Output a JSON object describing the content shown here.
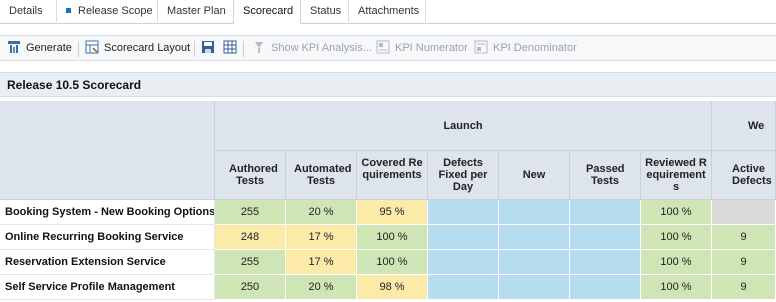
{
  "tabs": [
    {
      "label": "Details"
    },
    {
      "label": "Release Scope",
      "marked": true
    },
    {
      "label": "Master Plan"
    },
    {
      "label": "Scorecard",
      "active": true
    },
    {
      "label": "Status"
    },
    {
      "label": "Attachments"
    }
  ],
  "toolbar": {
    "generate": "Generate",
    "scorecard_layout": "Scorecard Layout",
    "show_kpi": "Show KPI Analysis...",
    "kpi_numerator": "KPI Numerator",
    "kpi_denominator": "KPI Denominator"
  },
  "title": "Release 10.5 Scorecard",
  "groups": {
    "launch": "Launch",
    "next": "We"
  },
  "columns": {
    "authored": "Authored Tests",
    "automated": "Automated Tests",
    "covered": "Covered Requirements",
    "defects_fixed": "Defects Fixed per Day",
    "new": "New",
    "passed": "Passed Tests",
    "reviewed": "Reviewed Requirements",
    "active_defects": "Active Defects"
  },
  "rows": [
    {
      "name": "Booking System - New Booking Options",
      "authored": "255",
      "automated": "20 %",
      "covered": "95 %",
      "reviewed": "100 %",
      "active_defects": ""
    },
    {
      "name": "Online Recurring Booking Service",
      "authored": "248",
      "automated": "17 %",
      "covered": "100 %",
      "reviewed": "100 %",
      "active_defects": "9"
    },
    {
      "name": "Reservation Extension Service",
      "authored": "255",
      "automated": "17 %",
      "covered": "100 %",
      "reviewed": "100 %",
      "active_defects": "9"
    },
    {
      "name": "Self Service Profile Management",
      "authored": "250",
      "automated": "20 %",
      "covered": "98 %",
      "reviewed": "100 %",
      "active_defects": "9"
    }
  ],
  "colors": {
    "green": "#cfe5b5",
    "yellow": "#fbeaa8",
    "blue": "#b8dcef",
    "gray": "#dadada",
    "header": "#dde4eb"
  }
}
